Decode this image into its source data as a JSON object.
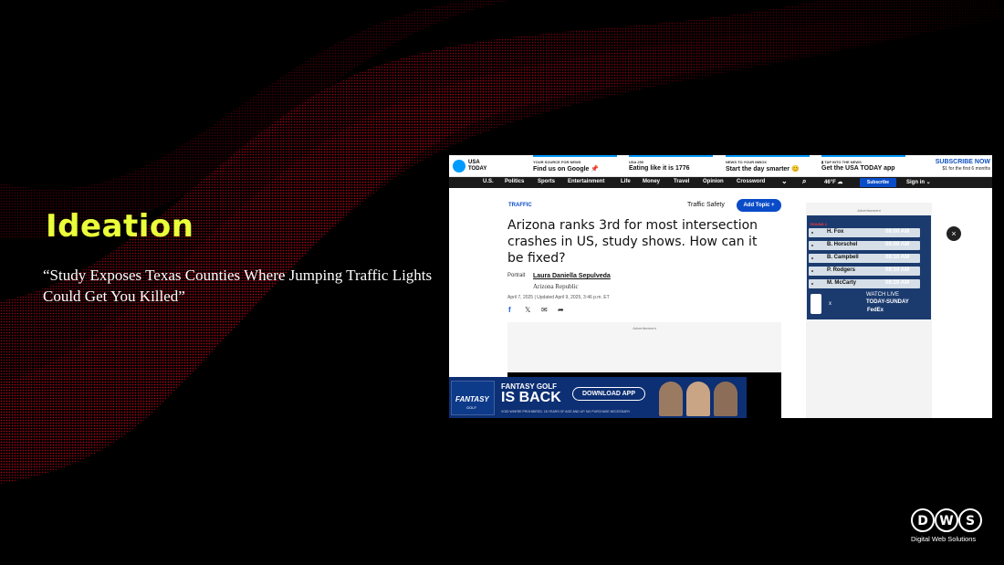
{
  "slide": {
    "title": "Ideation",
    "quote": "“Study Exposes Texas Counties Where Jumping Traffic Lights Could Get You Killed”",
    "colors": {
      "background": "#000000",
      "wave": "#c4001a",
      "title": "#eaff3a"
    }
  },
  "brand": {
    "logo_letters": [
      "D",
      "W",
      "S"
    ],
    "tagline": "Digital Web Solutions"
  },
  "screenshot": {
    "site_logo": "USA TODAY",
    "promos": [
      {
        "kicker": "YOUR SOURCE FOR NEWS",
        "main": "Find us on Google 📌"
      },
      {
        "kicker": "USA 250",
        "main": "Eating like it is 1776"
      },
      {
        "kicker": "NEWS TO YOUR INBOX",
        "main": "Start the day smarter 😊"
      },
      {
        "kicker": "▮ TAP INTO THE NEWS",
        "main": "Get the USA TODAY app"
      }
    ],
    "subscribe_now": "SUBSCRIBE NOW",
    "subscribe_offer": "$1 for the first 6 months",
    "nav": [
      "U.S.",
      "Politics",
      "Sports",
      "Entertainment",
      "Life",
      "Money",
      "Travel",
      "Opinion",
      "Crossword"
    ],
    "nav_chevron": "⌄",
    "nav_search": "⌕",
    "weather": "46°F ☁",
    "nav_subscribe": "Subscribe",
    "sign_in": "Sign in ⌄",
    "article": {
      "kicker": "TRAFFIC",
      "topic": "Traffic Safety",
      "add_topic": "Add Topic +",
      "headline": "Arizona ranks 3rd for most intersection crashes in US, study shows. How can it be fixed?",
      "portrait_alt": "Portrait",
      "author": "Laura Daniella Sepulveda",
      "outlet": "Arizona Republic",
      "dates": "April 7, 2025 | Updated April 9, 2025, 3:46 p.m. ET",
      "share_icons": [
        "facebook-icon",
        "x-icon",
        "mail-icon",
        "share-icon"
      ],
      "share_glyphs": [
        "f",
        "𝕏",
        "✉",
        "➦"
      ],
      "ad_label": "Advertisement"
    },
    "right_ad": {
      "label": "Advertisement",
      "round": "ROUND 1",
      "leaderboard": [
        {
          "name": "H. Fox",
          "time": "08:00 AM"
        },
        {
          "name": "B. Horschel",
          "time": "08:00 AM"
        },
        {
          "name": "B. Campbell",
          "time": "08:10 AM"
        },
        {
          "name": "P. Rodgers",
          "time": "08:10 AM"
        },
        {
          "name": "M. McCarty",
          "time": "08:20 AM"
        }
      ],
      "x": "x",
      "watch_1": "WATCH LIVE",
      "watch_2": "TODAY-SUNDAY",
      "sponsor": "FedEx"
    },
    "close": "×",
    "banner": {
      "logo_text": "FANTASY",
      "logo_sub": "GOLF",
      "line1": "FANTASY GOLF",
      "line2": "IS BACK",
      "button": "DOWNLOAD APP",
      "fine_print": "VOID WHERE PROHIBITED. 18 YEARS OF AGE AND UP. NO PURCHASE NECESSARY."
    }
  }
}
